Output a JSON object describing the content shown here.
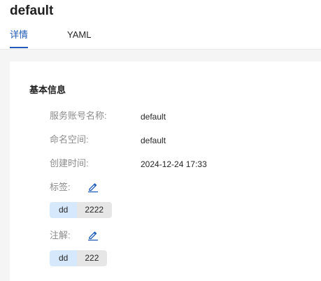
{
  "page": {
    "title": "default"
  },
  "tabs": [
    {
      "label": "详情",
      "active": true
    },
    {
      "label": "YAML",
      "active": false
    }
  ],
  "basic_info": {
    "section_title": "基本信息",
    "fields": [
      {
        "label": "服务账号名称:",
        "value": "default"
      },
      {
        "label": "命名空间:",
        "value": "default"
      },
      {
        "label": "创建时间:",
        "value": "2024-12-24 17:33"
      }
    ],
    "labels": {
      "label": "标签:",
      "edit_icon": "pencil-edit-icon",
      "items": [
        {
          "key": "dd",
          "value": "2222"
        }
      ]
    },
    "annotations": {
      "label": "注解:",
      "edit_icon": "pencil-edit-icon",
      "items": [
        {
          "key": "dd",
          "value": "222"
        }
      ]
    }
  },
  "colors": {
    "accent": "#1e5bb8",
    "tag_key_bg": "#d6e8fb",
    "tag_value_bg": "#e6e6e6",
    "page_bg": "#f5f5f5"
  }
}
